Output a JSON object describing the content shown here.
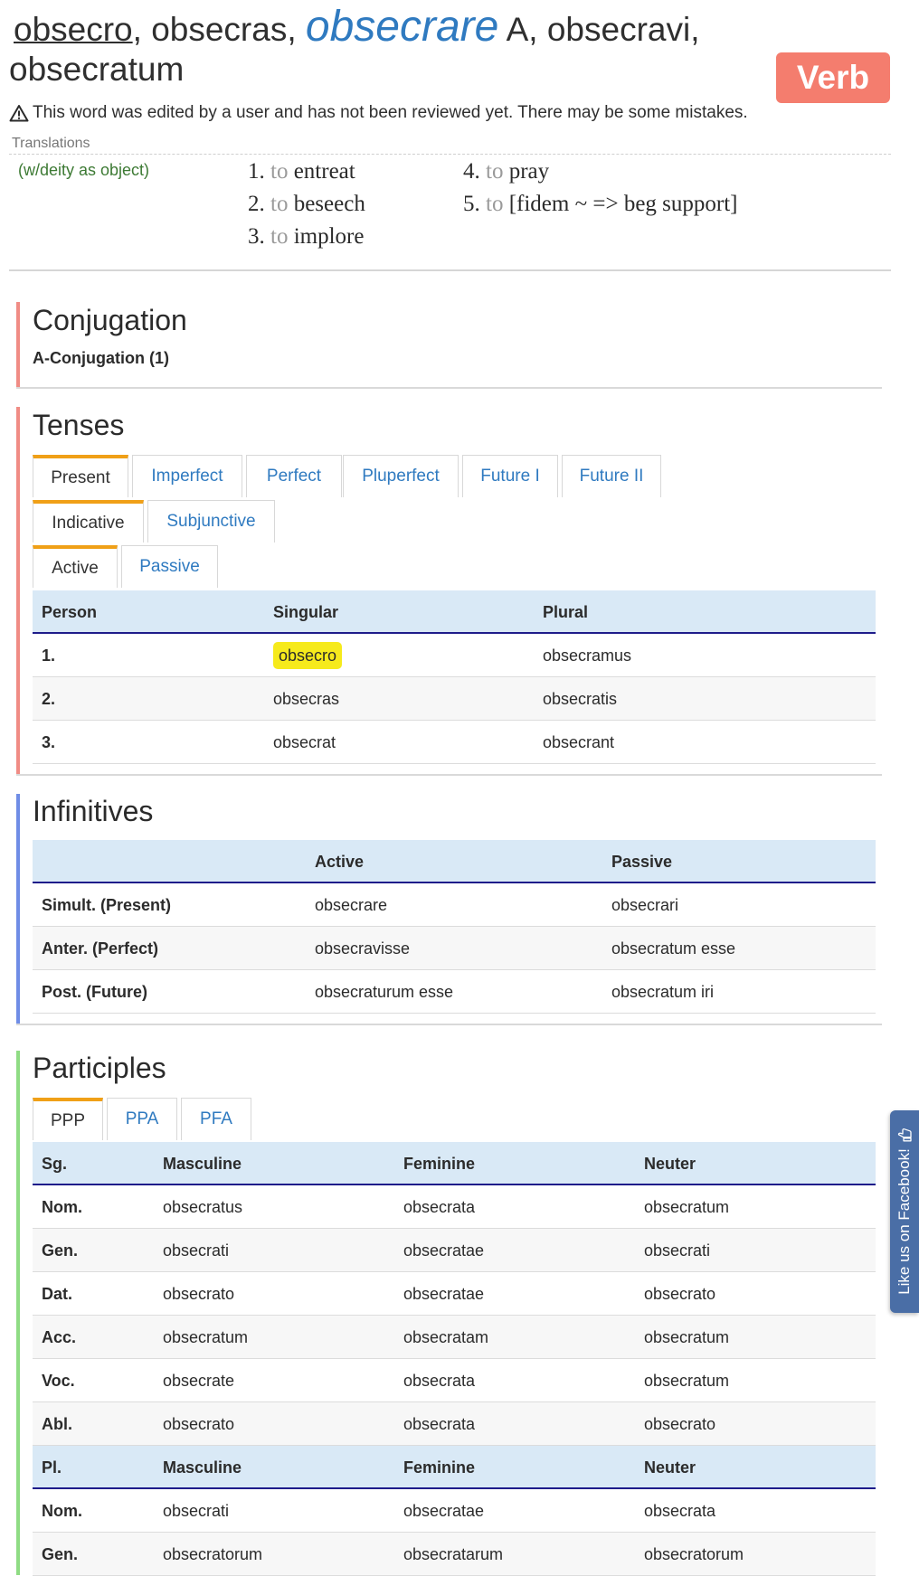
{
  "header": {
    "lemma": "obsecro",
    "part2": ", obsecras, ",
    "infinitive": "obsecrare",
    "part3": " A, obsecravi, obsecratum",
    "badge": "Verb",
    "warning": "This word was edited by a user and has not been reviewed yet. There may be some mistakes."
  },
  "translations": {
    "label": "Translations",
    "note": "(w/deity as object)",
    "items": [
      {
        "num": "1.",
        "to": "to",
        "text": "entreat"
      },
      {
        "num": "2.",
        "to": "to",
        "text": "beseech"
      },
      {
        "num": "3.",
        "to": "to",
        "text": "implore"
      },
      {
        "num": "4.",
        "to": "to",
        "text": "pray"
      },
      {
        "num": "5.",
        "to": "to",
        "text": "[fidem ~ => beg support]"
      }
    ]
  },
  "conjugation": {
    "title": "Conjugation",
    "subtitle": "A-Conjugation (1)"
  },
  "tenses": {
    "title": "Tenses",
    "tense_tabs": [
      "Present",
      "Imperfect",
      "Perfect",
      "Pluperfect",
      "Future I",
      "Future II"
    ],
    "mood_tabs": [
      "Indicative",
      "Subjunctive"
    ],
    "voice_tabs": [
      "Active",
      "Passive"
    ],
    "headers": [
      "Person",
      "Singular",
      "Plural"
    ],
    "rows": [
      [
        "1.",
        "obsecro",
        "obsecramus"
      ],
      [
        "2.",
        "obsecras",
        "obsecratis"
      ],
      [
        "3.",
        "obsecrat",
        "obsecrant"
      ]
    ]
  },
  "infinitives": {
    "title": "Infinitives",
    "headers": [
      "",
      "Active",
      "Passive"
    ],
    "rows": [
      [
        "Simult. (Present)",
        "obsecrare",
        "obsecrari"
      ],
      [
        "Anter. (Perfect)",
        "obsecravisse",
        "obsecratum esse"
      ],
      [
        "Post. (Future)",
        "obsecraturum esse",
        "obsecratum iri"
      ]
    ]
  },
  "participles": {
    "title": "Participles",
    "tabs": [
      "PPP",
      "PPA",
      "PFA"
    ],
    "sg_headers": [
      "Sg.",
      "Masculine",
      "Feminine",
      "Neuter"
    ],
    "sg_rows": [
      [
        "Nom.",
        "obsecratus",
        "obsecrata",
        "obsecratum"
      ],
      [
        "Gen.",
        "obsecrati",
        "obsecratae",
        "obsecrati"
      ],
      [
        "Dat.",
        "obsecrato",
        "obsecratae",
        "obsecrato"
      ],
      [
        "Acc.",
        "obsecratum",
        "obsecratam",
        "obsecratum"
      ],
      [
        "Voc.",
        "obsecrate",
        "obsecrata",
        "obsecratum"
      ],
      [
        "Abl.",
        "obsecrato",
        "obsecrata",
        "obsecrato"
      ]
    ],
    "pl_headers": [
      "Pl.",
      "Masculine",
      "Feminine",
      "Neuter"
    ],
    "pl_rows": [
      [
        "Nom.",
        "obsecrati",
        "obsecratae",
        "obsecrata"
      ],
      [
        "Gen.",
        "obsecratorum",
        "obsecratarum",
        "obsecratorum"
      ]
    ]
  },
  "facebook": {
    "label": "Like us on Facebook!",
    "icon": "thumbs-up-icon"
  },
  "colors": {
    "link": "#2f7ac0",
    "badge": "#f47d6e",
    "tab_active": "#f0a017",
    "table_header": "#d9e9f6",
    "tenses_bar": "#f08c85",
    "infinitives_bar": "#6f8de6",
    "participles_bar": "#8fdc84",
    "highlight": "#f6ea1c",
    "note": "#3d7a34"
  }
}
